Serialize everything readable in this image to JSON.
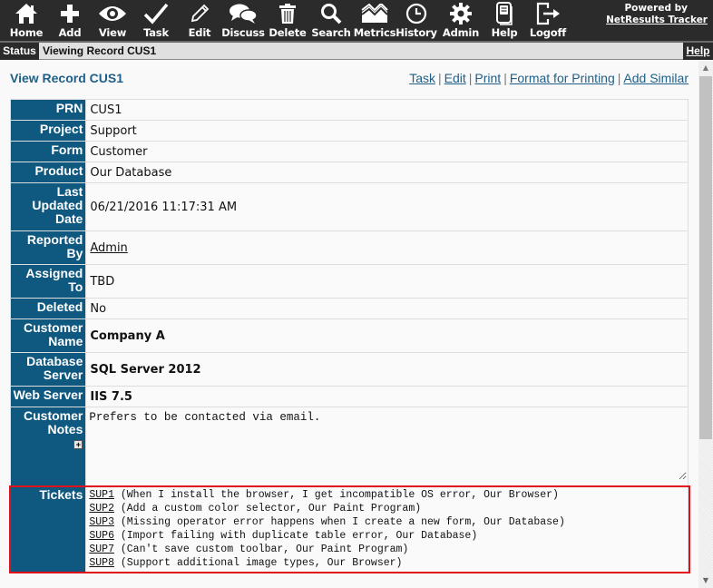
{
  "toolbar": {
    "items": [
      {
        "label": "Home",
        "icon": "home-icon"
      },
      {
        "label": "Add",
        "icon": "plus-icon"
      },
      {
        "label": "View",
        "icon": "eye-icon"
      },
      {
        "label": "Task",
        "icon": "checkmark-icon"
      },
      {
        "label": "Edit",
        "icon": "pencil-icon"
      },
      {
        "label": "Discuss",
        "icon": "chat-bubbles-icon"
      },
      {
        "label": "Delete",
        "icon": "trash-icon"
      },
      {
        "label": "Search",
        "icon": "magnifier-icon"
      },
      {
        "label": "Metrics",
        "icon": "chart-icon"
      },
      {
        "label": "History",
        "icon": "clock-icon"
      },
      {
        "label": "Admin",
        "icon": "gear-icon"
      },
      {
        "label": "Help",
        "icon": "document-icon"
      },
      {
        "label": "Logoff",
        "icon": "logout-icon"
      }
    ],
    "powered_by": "Powered by",
    "brand_link": "NetResults Tracker"
  },
  "statusbar": {
    "label": "Status",
    "text": "Viewing Record CUS1",
    "help": "Help"
  },
  "page": {
    "title": "View Record CUS1",
    "actions": [
      "Task",
      "Edit",
      "Print",
      "Format for Printing",
      "Add Similar"
    ]
  },
  "record": {
    "prn": {
      "label": "PRN",
      "value": "CUS1"
    },
    "project": {
      "label": "Project",
      "value": "Support"
    },
    "form": {
      "label": "Form",
      "value": "Customer"
    },
    "product": {
      "label": "Product",
      "value": "Our Database"
    },
    "last_updated": {
      "label": "Last Updated Date",
      "value": "06/21/2016 11:17:31 AM"
    },
    "reported_by": {
      "label": "Reported By",
      "value": "Admin"
    },
    "assigned_to": {
      "label": "Assigned To",
      "value": "TBD"
    },
    "deleted": {
      "label": "Deleted",
      "value": "No"
    },
    "customer_name": {
      "label": "Customer Name",
      "value": "Company A"
    },
    "database_server": {
      "label": "Database Server",
      "value": "SQL Server 2012"
    },
    "web_server": {
      "label": "Web Server",
      "value": "IIS 7.5"
    },
    "customer_notes": {
      "label": "Customer Notes",
      "value": "Prefers to be contacted via email."
    },
    "tickets": {
      "label": "Tickets",
      "items": [
        {
          "id": "SUP1",
          "desc": "(When I install the browser, I get incompatible OS error, Our Browser)"
        },
        {
          "id": "SUP2",
          "desc": "(Add a custom color selector, Our Paint Program)"
        },
        {
          "id": "SUP3",
          "desc": "(Missing operator error happens when I create a new form, Our Database)"
        },
        {
          "id": "SUP6",
          "desc": "(Import failing with duplicate table error, Our Database)"
        },
        {
          "id": "SUP7",
          "desc": "(Can't save custom toolbar, Our Paint Program)"
        },
        {
          "id": "SUP8",
          "desc": "(Support additional image types, Our Browser)"
        }
      ]
    }
  },
  "colors": {
    "toolbar_bg": "#2b2b2b",
    "label_bg": "#0f5880",
    "link": "#1f5f87",
    "highlight": "#e0111b"
  }
}
